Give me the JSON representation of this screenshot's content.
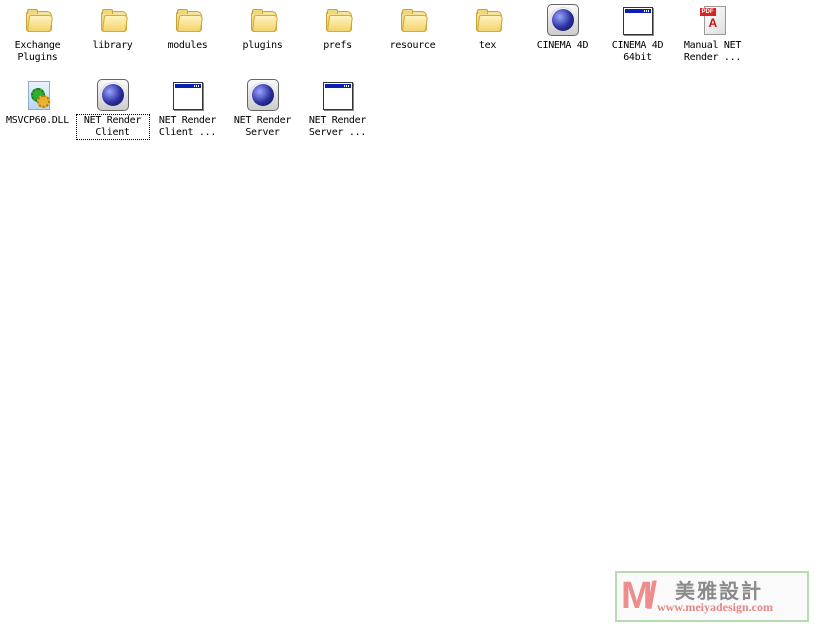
{
  "desktop_items": [
    {
      "label": "Exchange\nPlugins",
      "icon": "folder-icon"
    },
    {
      "label": "library",
      "icon": "folder-icon"
    },
    {
      "label": "modules",
      "icon": "folder-icon"
    },
    {
      "label": "plugins",
      "icon": "folder-icon"
    },
    {
      "label": "prefs",
      "icon": "folder-icon"
    },
    {
      "label": "resource",
      "icon": "folder-icon"
    },
    {
      "label": "tex",
      "icon": "folder-icon"
    },
    {
      "label": "CINEMA 4D",
      "icon": "cinema4d-icon"
    },
    {
      "label": "CINEMA 4D\n64bit",
      "icon": "application-icon"
    },
    {
      "label": "Manual NET\nRender ...",
      "icon": "pdf-icon"
    },
    {
      "label": "MSVCP60.DLL",
      "icon": "dll-icon"
    },
    {
      "label": "NET Render\nClient",
      "icon": "cinema4d-icon",
      "selected": true
    },
    {
      "label": "NET Render\nClient ...",
      "icon": "application-icon"
    },
    {
      "label": "NET Render\nServer",
      "icon": "cinema4d-icon"
    },
    {
      "label": "NET Render\nServer ...",
      "icon": "application-icon"
    }
  ],
  "watermark": {
    "logo": "M/",
    "name": "美雅設計",
    "url": "www.meiyadesign.com"
  }
}
